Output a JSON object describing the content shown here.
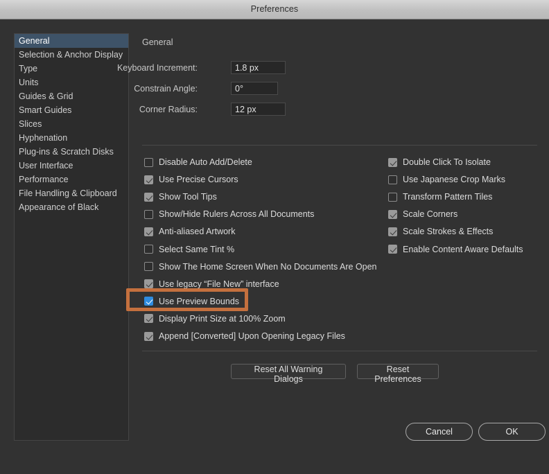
{
  "window": {
    "title": "Preferences"
  },
  "sidebar": {
    "items": [
      {
        "label": "General",
        "selected": true
      },
      {
        "label": "Selection & Anchor Display",
        "selected": false
      },
      {
        "label": "Type",
        "selected": false
      },
      {
        "label": "Units",
        "selected": false
      },
      {
        "label": "Guides & Grid",
        "selected": false
      },
      {
        "label": "Smart Guides",
        "selected": false
      },
      {
        "label": "Slices",
        "selected": false
      },
      {
        "label": "Hyphenation",
        "selected": false
      },
      {
        "label": "Plug-ins & Scratch Disks",
        "selected": false
      },
      {
        "label": "User Interface",
        "selected": false
      },
      {
        "label": "Performance",
        "selected": false
      },
      {
        "label": "File Handling & Clipboard",
        "selected": false
      },
      {
        "label": "Appearance of Black",
        "selected": false
      }
    ]
  },
  "panel": {
    "title": "General",
    "fields": [
      {
        "label": "Keyboard Increment:",
        "value": "1.8 px"
      },
      {
        "label": "Constrain Angle:",
        "value": "0°"
      },
      {
        "label": "Corner Radius:",
        "value": "12 px"
      }
    ],
    "checkboxes_left": [
      {
        "label": "Disable Auto Add/Delete",
        "state": "off"
      },
      {
        "label": "Use Precise Cursors",
        "state": "on"
      },
      {
        "label": "Show Tool Tips",
        "state": "on"
      },
      {
        "label": "Show/Hide Rulers Across All Documents",
        "state": "off"
      },
      {
        "label": "Anti-aliased Artwork",
        "state": "on"
      },
      {
        "label": "Select Same Tint %",
        "state": "off"
      },
      {
        "label": "Show The Home Screen When No Documents Are Open",
        "state": "off"
      },
      {
        "label": "Use legacy “File New” interface",
        "state": "on"
      },
      {
        "label": "Use Preview Bounds",
        "state": "accent"
      },
      {
        "label": "Display Print Size at 100% Zoom",
        "state": "on"
      },
      {
        "label": "Append [Converted] Upon Opening Legacy Files",
        "state": "on"
      }
    ],
    "checkboxes_right": [
      {
        "label": "Double Click To Isolate",
        "state": "on"
      },
      {
        "label": "Use Japanese Crop Marks",
        "state": "off"
      },
      {
        "label": "Transform Pattern Tiles",
        "state": "off"
      },
      {
        "label": "Scale Corners",
        "state": "on"
      },
      {
        "label": "Scale Strokes & Effects",
        "state": "on"
      },
      {
        "label": "Enable Content Aware Defaults",
        "state": "on"
      }
    ],
    "reset_buttons": [
      {
        "label": "Reset All Warning Dialogs"
      },
      {
        "label": "Reset Preferences"
      }
    ]
  },
  "footer": {
    "cancel_label": "Cancel",
    "ok_label": "OK"
  },
  "annotation": {
    "target_label": "Use Preview Bounds",
    "color": "#c4703e"
  },
  "colors": {
    "dialog_background": "#323232",
    "titlebar": "#c6c6c6",
    "sidebar_selected": "#3e5368",
    "accent_checkbox": "#2f8cdf",
    "highlight_border": "#c4703e"
  }
}
